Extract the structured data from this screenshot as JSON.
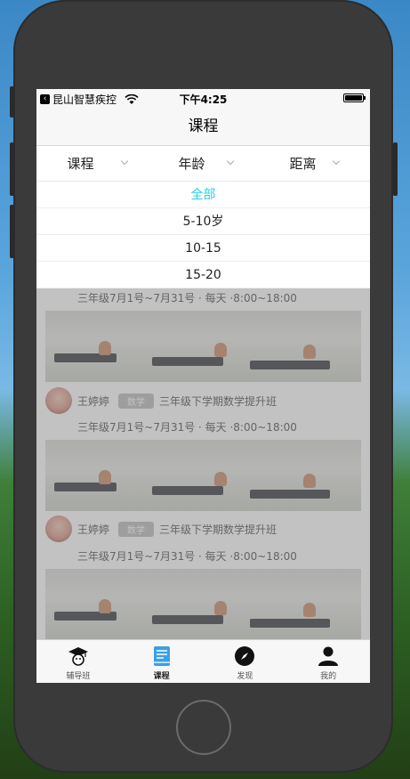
{
  "status_bar": {
    "carrier": "昆山智慧疾控",
    "time": "下午4:25",
    "back_icon": "back-arrow-icon",
    "wifi_icon": "wifi-icon",
    "battery_icon": "battery-icon"
  },
  "nav": {
    "title": "课程"
  },
  "filters": [
    {
      "label": "课程"
    },
    {
      "label": "年龄"
    },
    {
      "label": "距离"
    }
  ],
  "dropdown": {
    "options": [
      {
        "label": "全部",
        "selected": true
      },
      {
        "label": "5-10岁",
        "selected": false
      },
      {
        "label": "10-15",
        "selected": false
      },
      {
        "label": "15-20",
        "selected": false
      }
    ],
    "selected_color": "#22d3e6"
  },
  "courses": [
    {
      "schedule": "三年级7月1号~7月31号 · 每天 ·8:00~18:00"
    },
    {
      "teacher": "王婷婷",
      "subject": "数学",
      "title": "三年级下学期数学提升班",
      "schedule": "三年级7月1号~7月31号 · 每天 ·8:00~18:00"
    },
    {
      "teacher": "王婷婷",
      "subject": "数学",
      "title": "三年级下学期数学提升班",
      "schedule": "三年级7月1号~7月31号 · 每天 ·8:00~18:00"
    }
  ],
  "tabs": [
    {
      "label": "辅导班",
      "icon": "graduation-cap-icon",
      "active": false
    },
    {
      "label": "课程",
      "icon": "book-icon",
      "active": true
    },
    {
      "label": "发现",
      "icon": "compass-icon",
      "active": false
    },
    {
      "label": "我的",
      "icon": "person-icon",
      "active": false
    }
  ],
  "colors": {
    "accent": "#3aa0e6",
    "overlay": "#787878",
    "background_gray": "#f7f7f7"
  }
}
